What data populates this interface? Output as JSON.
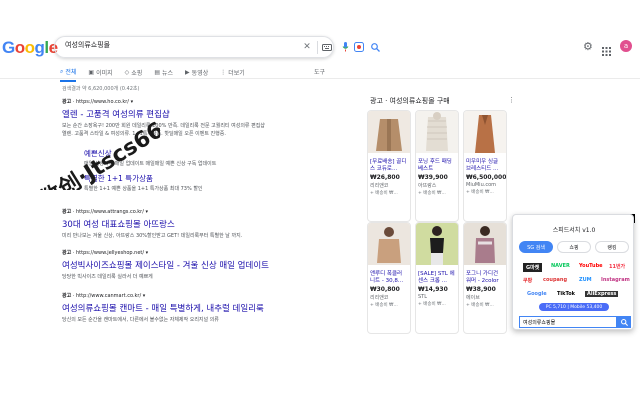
{
  "logo": {
    "g1": "G",
    "g2": "o",
    "g3": "o",
    "g4": "g",
    "g5": "l",
    "g6": "e"
  },
  "search": {
    "value": "여성의류쇼핑몰"
  },
  "avatar": {
    "letter": "a"
  },
  "tabs": [
    {
      "label": "전체",
      "icon": "search-icon"
    },
    {
      "label": "이미지",
      "icon": "image-icon"
    },
    {
      "label": "쇼핑",
      "icon": "tag-icon"
    },
    {
      "label": "뉴스",
      "icon": "news-icon"
    },
    {
      "label": "동영상",
      "icon": "video-icon"
    },
    {
      "label": "더보기",
      "icon": "more-icon"
    }
  ],
  "tools_label": "도구",
  "stats": "검색결과 약 6,620,000개 (0.42초)",
  "results": [
    {
      "ad": "광고",
      "url": "https://www.ho",
      "url_tail": ".co.kr/",
      "title": "엘렌 - 고품격 여성의류 편집샵",
      "desc1": "보는 순간 소장욕구! 200만 회원 데일리룩 200% 만족. 데일리룩 전문 고퀄리티 여성의류 편집샵",
      "desc2": "엘렌. 고품격 스타일 & 여성의류. 1+1특가상품. 핫딜매일 오픈 이벤트 진행중."
    }
  ],
  "sitelinks": [
    {
      "title": "예쁜신상",
      "desc": "매일 신상의류 매일 업데이트 매일매일 예쁜 신상 구독 업데이트"
    },
    {
      "title": "특별한 1+1 특가상품",
      "desc": "특별한 1+1 예쁜 상품을 1+1 특가상품 최대 73% 할인"
    }
  ],
  "results2": [
    {
      "ad": "광고",
      "url": "https://www.attrangs.co.kr/",
      "title": "30대 여성 대표쇼핑몰 아뜨랑스",
      "desc": "미리 만나보는 겨울 신상, 아뜨랑스 30%할인받고 GET! 데일리룩부터 특별한 날 까지."
    },
    {
      "ad": "광고",
      "url": "https://www.jellyeshop.net/",
      "title": "여성빅사이즈쇼핑몰 제이스타일 - 겨울 신상 매일 업데이트",
      "desc": "당당한 빅사이즈 데일리룩 실라서 더 예쁘게"
    },
    {
      "ad": "광고",
      "url": "http://www.canmart.co.kr/",
      "title": "여성의류쇼핑몰 캔마트 - 매일 특별하게, 내추럴 데일리룩",
      "desc": "당신의 모든 순간을 캔마트에서, 다른에서 볼수없는 자체제작 오리지널 의류"
    }
  ],
  "shopping": {
    "header": "광고 · 여성의류쇼핑몰 구매",
    "more": "⋮",
    "products": [
      {
        "title": "[무료배송] 골디스 코듀로...",
        "price": "₩26,800",
        "store": "리리앤코",
        "shipping": "+ 배송비 ₩...",
        "color": "#b58e6a"
      },
      {
        "title": "포닝 후드 패딩 베스트",
        "price": "₩39,900",
        "store": "아뜨랑스",
        "shipping": "+ 배송비 ₩...",
        "color": "#e3ddd3"
      },
      {
        "title": "미우미우 싱글 브레스티드 ...",
        "price": "₩6,500,000",
        "store": "MiuMiu.com",
        "shipping": "+ 배송비 ₩...",
        "color": "#b87146"
      },
      {
        "title": "앤루디 폭클러 니트 - 30,8...",
        "price": "₩30,800",
        "store": "리리앤코",
        "shipping": "+ 배송비 ₩...",
        "color": "#c9a07e"
      },
      {
        "title": "[SALE] STL 에센스 크롭 ...",
        "price": "₩14,930",
        "store": "STL",
        "shipping": "+ 배송비 ₩...",
        "color": "#d0dca0"
      },
      {
        "title": "포그니 가디건 워머 - 2color",
        "price": "₩38,900",
        "store": "에이브",
        "shipping": "+ 배송비 ₩...",
        "color": "#e6e0d8"
      }
    ]
  },
  "watermark": "数创·Jtscs66",
  "ext": {
    "close": "x",
    "title": "스피드서치 v1.0",
    "tabs": [
      "SG 검색",
      "쇼핑",
      "랭킹"
    ],
    "malls": [
      {
        "label": "G마켓",
        "color": "#222222"
      },
      {
        "label": "NAVER",
        "color": "#03c75a"
      },
      {
        "label": "YouTube",
        "color": "#ff0000"
      },
      {
        "label": "11번가",
        "color": "#f43142"
      },
      {
        "label": "쿠팡",
        "color": "#e52528"
      },
      {
        "label": "coupang",
        "color": "#d33"
      },
      {
        "label": "ZUM",
        "color": "#1e90ff"
      },
      {
        "label": "Instagram",
        "color": "#c13584"
      },
      {
        "label": "Google",
        "color": "#4285f4"
      },
      {
        "label": "TikTok",
        "color": "#000000"
      },
      {
        "label": "AliExpress",
        "color": "#333333"
      }
    ],
    "badge": "PC 5,710 | Mobile 53,400",
    "input": "여성의류쇼핑몰",
    "go": "⌕"
  }
}
